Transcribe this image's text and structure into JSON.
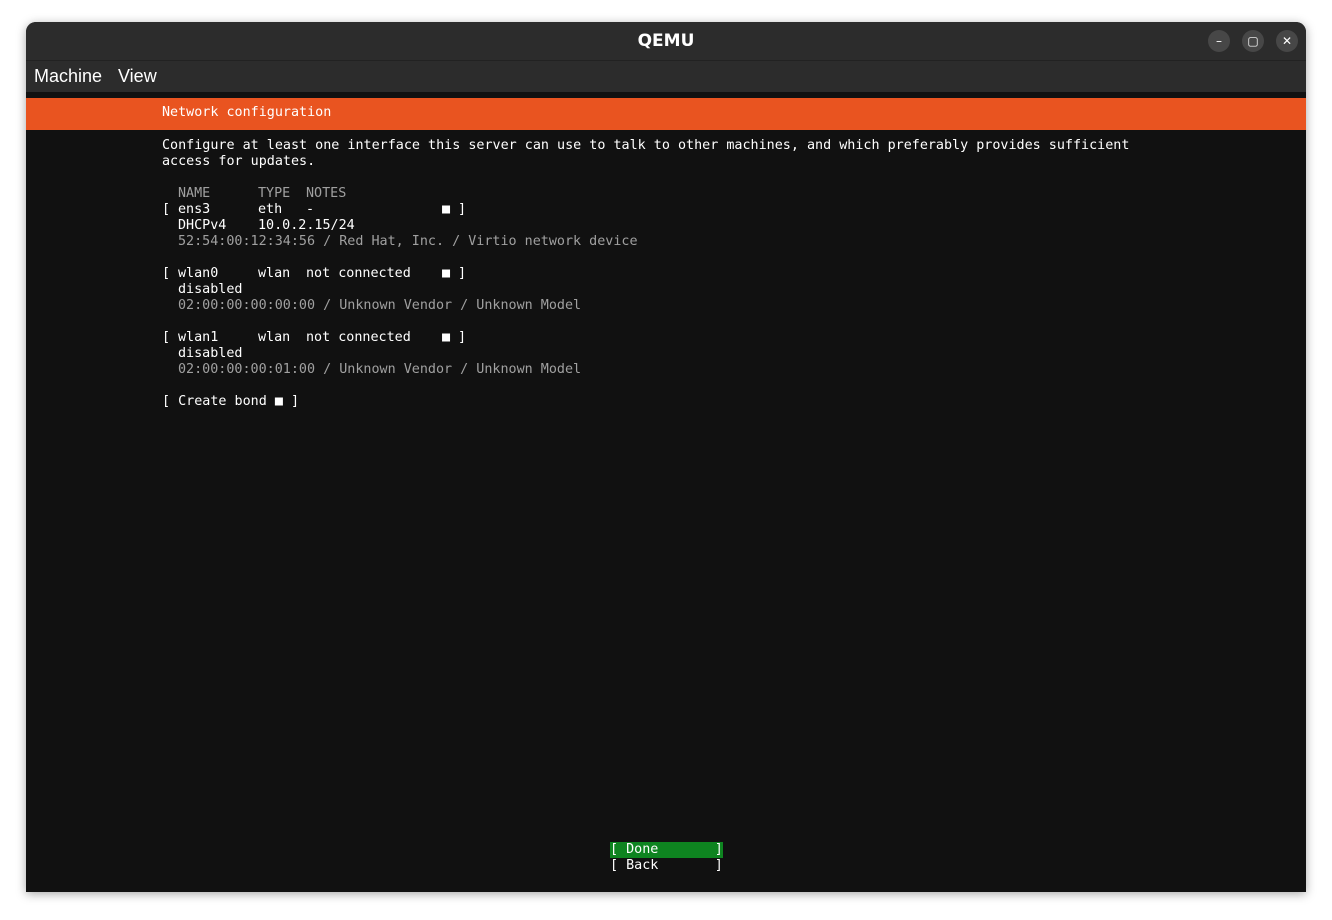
{
  "window": {
    "title": "QEMU",
    "minimize_icon": "minimize-icon",
    "maximize_icon": "maximize-icon",
    "close_icon": "close-icon",
    "minimize_glyph": "–",
    "maximize_glyph": "▢",
    "close_glyph": "✕"
  },
  "menubar": {
    "items": [
      {
        "label": "Machine"
      },
      {
        "label": "View"
      }
    ]
  },
  "screen": {
    "header": "Network configuration",
    "header_color": "#e95420",
    "intro": [
      "Configure at least one interface this server can use to talk to other machines, and which preferably provides sufficient",
      "access for updates."
    ],
    "columns": {
      "name": "NAME",
      "type": "TYPE",
      "notes": "NOTES"
    },
    "interfaces": [
      {
        "open": "[",
        "name": "ens3",
        "type": "eth",
        "notes": "-",
        "marker": "■",
        "close": "]",
        "status_label": "DHCPv4",
        "status_value": "10.0.2.15/24",
        "details": "52:54:00:12:34:56 / Red Hat, Inc. / Virtio network device"
      },
      {
        "open": "[",
        "name": "wlan0",
        "type": "wlan",
        "notes": "not connected",
        "marker": "■",
        "close": "]",
        "status_label": "disabled",
        "status_value": "",
        "details": "02:00:00:00:00:00 / Unknown Vendor / Unknown Model"
      },
      {
        "open": "[",
        "name": "wlan1",
        "type": "wlan",
        "notes": "not connected",
        "marker": "■",
        "close": "]",
        "status_label": "disabled",
        "status_value": "",
        "details": "02:00:00:00:01:00 / Unknown Vendor / Unknown Model"
      }
    ],
    "create_bond": "[ Create bond ■ ]",
    "buttons": {
      "done": "[ Done       ]",
      "back": "[ Back       ]"
    },
    "done_color": "#0e8420"
  }
}
